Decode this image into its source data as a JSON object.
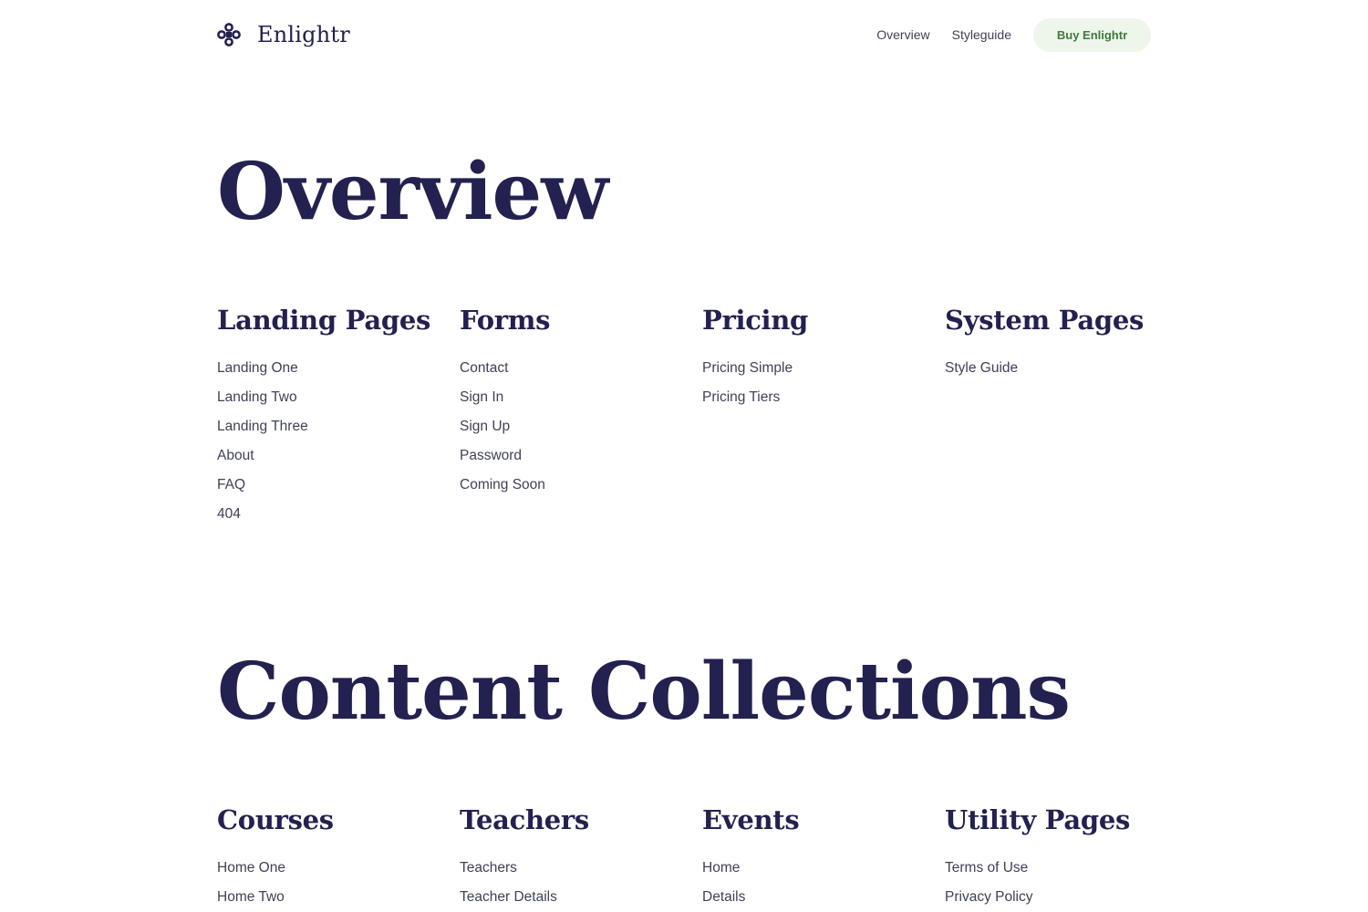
{
  "header": {
    "brand_name": "Enlightr",
    "nav": [
      {
        "label": "Overview"
      },
      {
        "label": "Styleguide"
      }
    ],
    "cta_label": "Buy Enlightr"
  },
  "colors": {
    "heading": "#232150",
    "body_text": "#3f4257",
    "cta_background": "#eef6ec",
    "cta_text": "#3f7a3a"
  },
  "overview": {
    "title": "Overview",
    "columns": [
      {
        "title": "Landing Pages",
        "links": [
          "Landing One",
          "Landing Two",
          "Landing Three",
          "About",
          "FAQ",
          "404"
        ]
      },
      {
        "title": "Forms",
        "links": [
          "Contact",
          "Sign In",
          "Sign Up",
          "Password",
          "Coming Soon"
        ]
      },
      {
        "title": "Pricing",
        "links": [
          "Pricing Simple",
          "Pricing Tiers"
        ]
      },
      {
        "title": "System Pages",
        "links": [
          "Style Guide"
        ]
      }
    ]
  },
  "content_collections": {
    "title": "Content Collections",
    "columns": [
      {
        "title": "Courses",
        "links": [
          "Home One",
          "Home Two"
        ]
      },
      {
        "title": "Teachers",
        "links": [
          "Teachers",
          "Teacher Details"
        ]
      },
      {
        "title": "Events",
        "links": [
          "Home",
          "Details"
        ]
      },
      {
        "title": "Utility Pages",
        "links": [
          "Terms of Use",
          "Privacy Policy"
        ]
      }
    ]
  }
}
